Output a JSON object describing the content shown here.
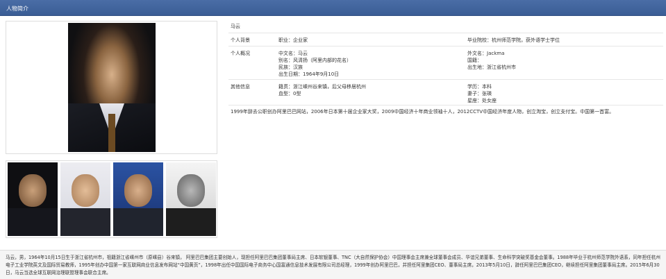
{
  "header": {
    "title": "人物简介"
  },
  "profile": {
    "name": "马云",
    "rows": [
      {
        "label": "个人背景",
        "mid": [
          "职业：企业家"
        ],
        "right": [
          "毕业院校：杭州师范学院，获外语学士学位"
        ]
      },
      {
        "label": "个人概况",
        "mid": [
          "中文名：马云",
          "别名：风清扬（阿里内部的花名）",
          "民族：汉族",
          "出生日期：1964年9月10日"
        ],
        "right": [
          "外文名：Jackma",
          "国籍：",
          "出生地：浙江省杭州市"
        ]
      },
      {
        "label": "其他信息",
        "mid": [
          "籍贯：浙江嵊州谷来镇，后父母移居杭州",
          "血型：0型"
        ],
        "right": [
          "学历：本科",
          "妻子：张瑛",
          "星座：处女座"
        ]
      }
    ],
    "summary": "1999年辞去公职创办阿里巴巴网站，2006年日本第十届企业家大奖，2009中国经济十年商业领袖十人，2012CCTV中国经济年度人物，创立淘宝，创立支付宝。中国第一首富。"
  },
  "biography": "马云，男，1964年10月15日生于浙江省杭州市，祖籍浙江省嵊州市（原嵊县）谷来镇， 阿里巴巴集团主要创始人，现担任阿里巴巴集团董事局主席、日本软银董事、TNC（大自然保护协会）中国理事会主席兼全球董事会成员、华谊兄弟董事、生命科学突破奖基金会董事。1988年毕业于杭州师范学院外语系，同年担任杭州电子工业学院英文及国际贸易教师，1995年创办中国第一家互联网商业信息发布网站“中国黄页”，1998年出任中国国际电子商务中心国富通信息技术发展有限公司总经理，1999年创办阿里巴巴，并担任阿里集团CEO、董事局主席，2013年5月10日，辞任阿里巴巴集团CEO，继续担任阿里集团董事局主席。2015年6月30日，马云当选全球互联网治理联盟理事会联合主席。"
}
